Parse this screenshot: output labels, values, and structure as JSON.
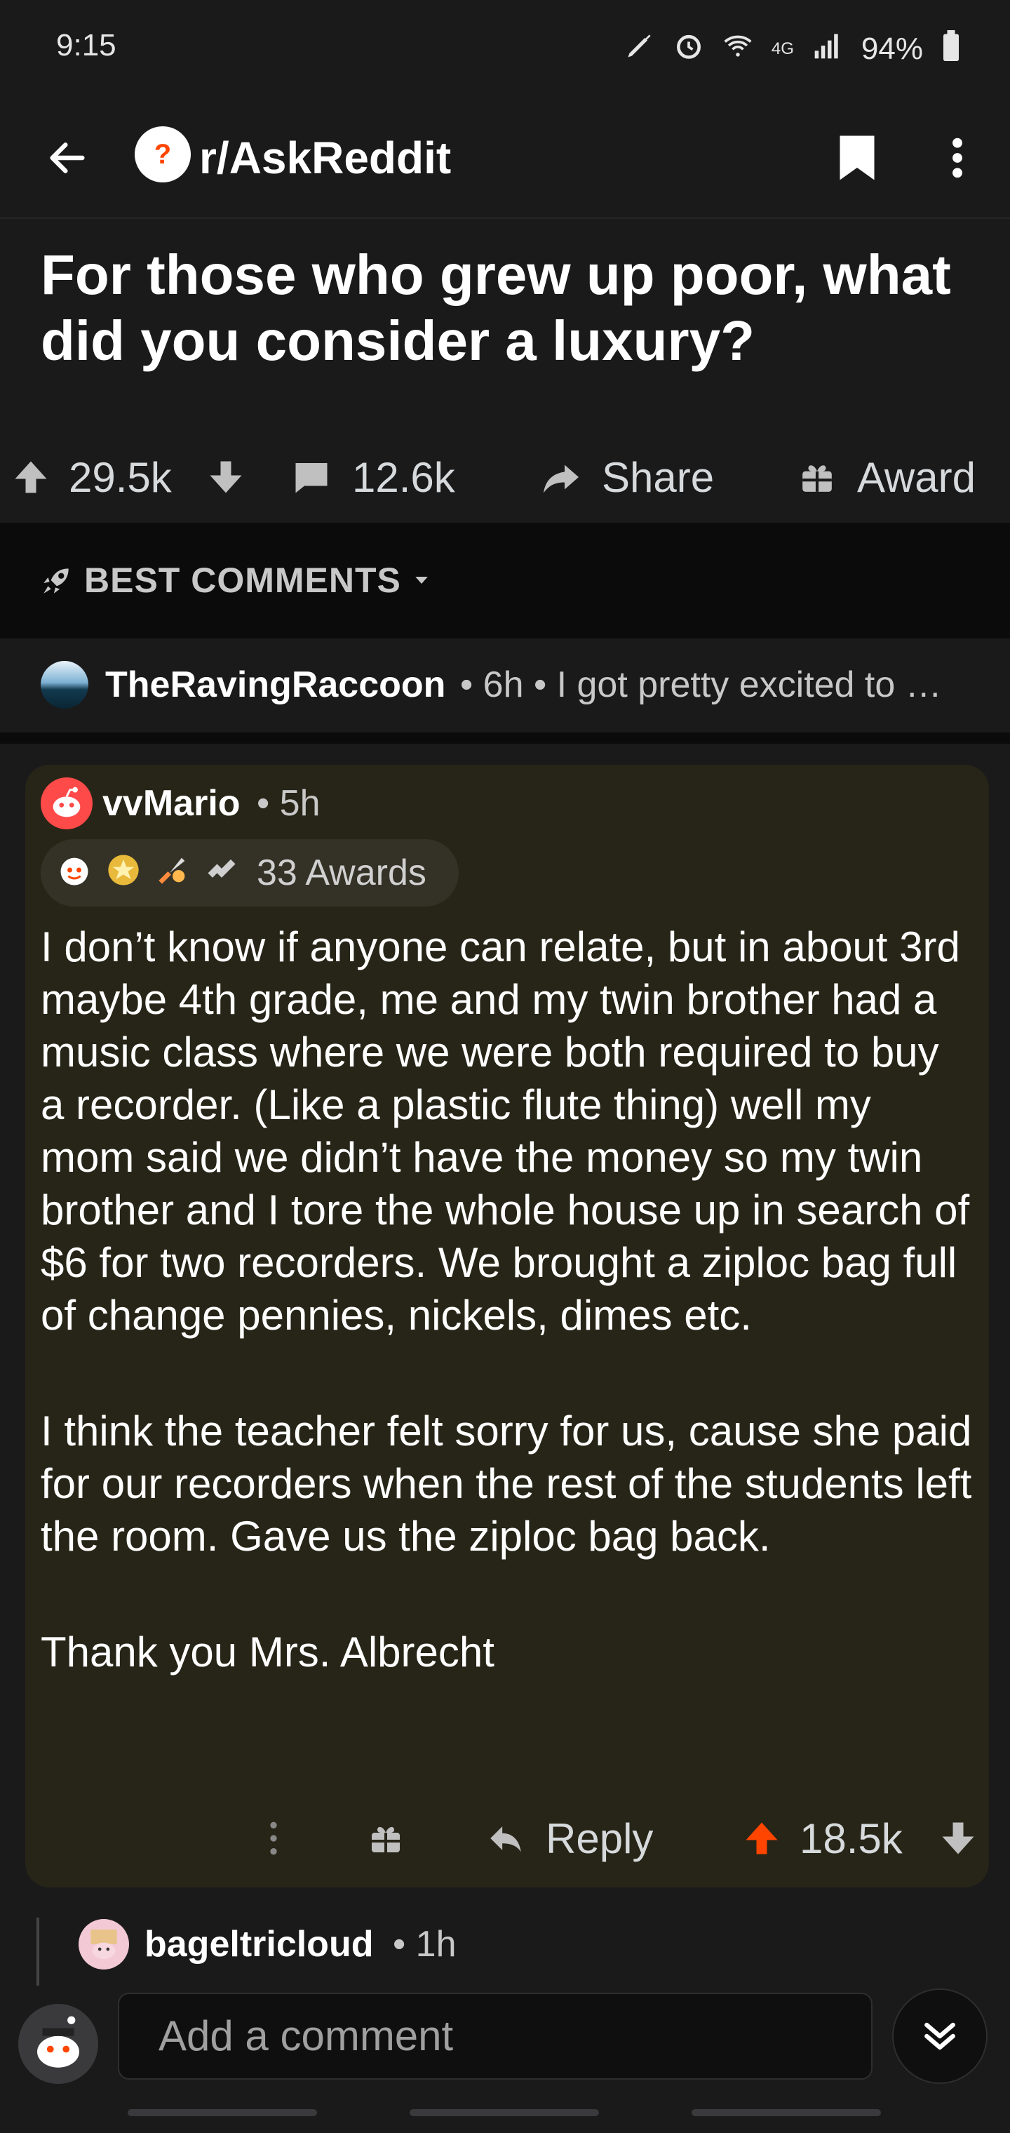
{
  "status_bar": {
    "time": "9:15",
    "network": "4G",
    "battery_percent": "94%"
  },
  "header": {
    "subreddit": "r/AskReddit"
  },
  "post": {
    "title": "For those who grew up poor, what did you consider a luxury?",
    "score": "29.5k",
    "comments": "12.6k",
    "share_label": "Share",
    "award_label": "Award"
  },
  "sort": {
    "label": "BEST COMMENTS"
  },
  "collapsed_comment": {
    "author": "TheRavingRaccoon",
    "meta": "• 6h • I got pretty excited to …"
  },
  "comment": {
    "author": "vvMario",
    "age": "• 5h",
    "awards": "33 Awards",
    "paragraphs": [
      "I don’t know if anyone can relate, but in about 3rd maybe 4th grade, me and my twin brother had a music class where we were both required to buy a recorder. (Like a plastic flute thing) well my mom said we didn’t have the money so my twin brother and I tore the whole house up in search of $6 for two recorders. We brought a ziploc bag full of change pennies, nickels, dimes etc.",
      "I think the teacher felt sorry for us, cause she paid for our recorders when the rest of the students left the room. Gave us the ziploc bag back.",
      "Thank you Mrs. Albrecht"
    ],
    "reply_label": "Reply",
    "score": "18.5k",
    "upvote_color": "#ff4500"
  },
  "child_comment": {
    "author": "bageltricloud",
    "age": "• 1h"
  },
  "bottom": {
    "placeholder": "Add a comment"
  }
}
